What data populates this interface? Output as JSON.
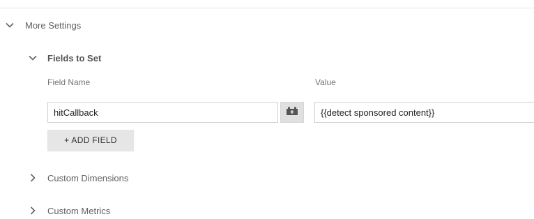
{
  "sections": {
    "more_settings": {
      "label": "More Settings",
      "expanded": true
    },
    "fields_to_set": {
      "label": "Fields to Set",
      "expanded": true
    },
    "custom_dimensions": {
      "label": "Custom Dimensions",
      "expanded": false
    },
    "custom_metrics": {
      "label": "Custom Metrics",
      "expanded": false
    }
  },
  "fields_table": {
    "columns": [
      "Field Name",
      "Value"
    ],
    "rows": [
      {
        "field_name": "hitCallback",
        "value": "{{detect sponsored content}}"
      }
    ],
    "add_field_label": "+ ADD FIELD"
  },
  "icons": {
    "expanded_chevron": "chevron-down-icon",
    "collapsed_chevron": "chevron-right-icon",
    "variable_picker": "variable-picker-icon"
  },
  "colors": {
    "chevron": "#616161",
    "button_bg": "#e6e6e6",
    "picker_bg": "#e0e0e0"
  }
}
